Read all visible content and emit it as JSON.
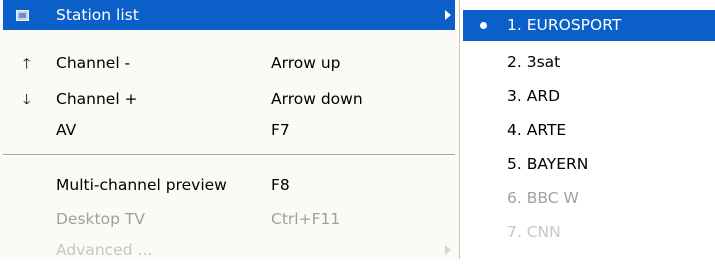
{
  "menu": {
    "items": [
      {
        "label": "Station list",
        "shortcut": "",
        "icon": "tv-icon"
      },
      {
        "label": "Channel -",
        "shortcut": "Arrow up",
        "icon": "arrow-up-icon"
      },
      {
        "label": "Channel +",
        "shortcut": "Arrow down",
        "icon": "arrow-down-icon"
      },
      {
        "label": "AV",
        "shortcut": "F7",
        "icon": ""
      },
      {
        "label": "Multi-channel preview",
        "shortcut": "F8",
        "icon": ""
      },
      {
        "label": "Desktop TV",
        "shortcut": "Ctrl+F11",
        "icon": "",
        "disabled": true
      },
      {
        "label": "Advanced ...",
        "shortcut": "",
        "icon": "",
        "disabled": true
      }
    ]
  },
  "station_list": {
    "selected_index": 0,
    "items": [
      {
        "label": "1. EUROSPORT"
      },
      {
        "label": "2. 3sat"
      },
      {
        "label": "3. ARD"
      },
      {
        "label": "4. ARTE"
      },
      {
        "label": "5. BAYERN"
      },
      {
        "label": "6. BBC W",
        "disabled": true
      },
      {
        "label": "7. CNN",
        "disabled": true
      }
    ]
  },
  "colors": {
    "highlight": "#0a5fc8",
    "menu_bg": "#fbfaf7",
    "disabled_text": "#a3a09a"
  }
}
